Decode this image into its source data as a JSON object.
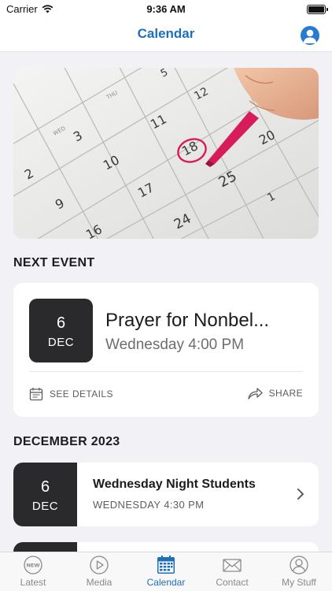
{
  "status_bar": {
    "carrier": "Carrier",
    "time": "9:36 AM"
  },
  "nav": {
    "title": "Calendar",
    "profile_icon": "person-icon"
  },
  "hero": {
    "image": "calendar-photo-with-red-marker",
    "visible_numbers": [
      "5",
      "12",
      "THU",
      "WED",
      "11",
      "3",
      "18",
      "10",
      "2",
      "25",
      "17",
      "20",
      "9",
      "24",
      "16",
      "1"
    ]
  },
  "next_event": {
    "heading": "NEXT EVENT",
    "day": "6",
    "month": "DEC",
    "title": "Prayer for Nonbel...",
    "time": "Wednesday 4:00 PM",
    "see_details_label": "SEE DETAILS",
    "share_label": "SHARE"
  },
  "month_section": {
    "heading": "DECEMBER 2023",
    "events": [
      {
        "day": "6",
        "month": "DEC",
        "title": "Wednesday Night Students",
        "time": "WEDNESDAY 4:30 PM"
      }
    ]
  },
  "tabs": [
    {
      "label": "Latest",
      "icon": "new-badge-icon",
      "active": false
    },
    {
      "label": "Media",
      "icon": "play-icon",
      "active": false
    },
    {
      "label": "Calendar",
      "icon": "calendar-icon",
      "active": true
    },
    {
      "label": "Contact",
      "icon": "envelope-icon",
      "active": false
    },
    {
      "label": "My Stuff",
      "icon": "person-icon",
      "active": false
    }
  ],
  "colors": {
    "accent": "#1f6fb8",
    "date_tile": "#2a2a2d",
    "background": "#f2f2f6",
    "marker": "#d81b5a"
  }
}
